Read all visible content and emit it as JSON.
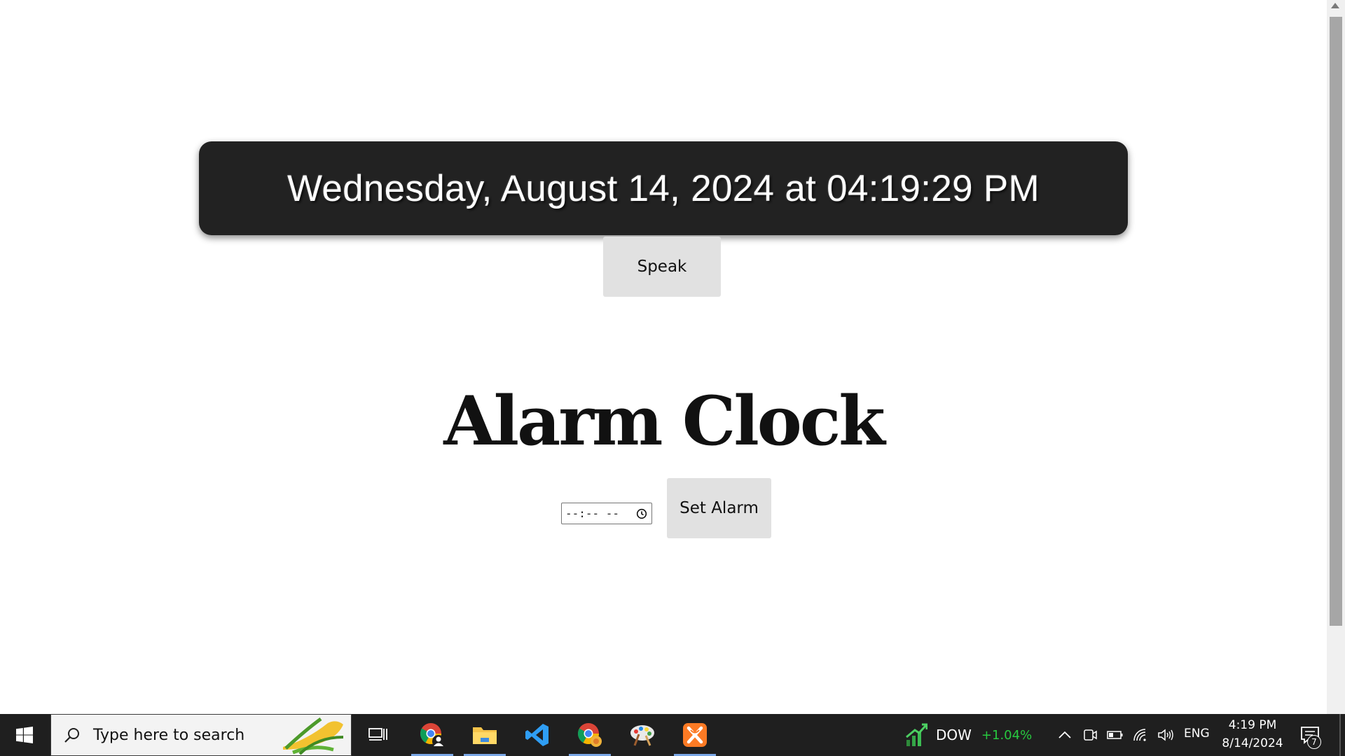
{
  "datetime": {
    "display": "Wednesday, August 14, 2024 at 04:19:29 PM"
  },
  "speak_button": {
    "label": "Speak"
  },
  "alarm": {
    "title": "Alarm Clock",
    "time_input_value": "--:-- --",
    "set_button_label": "Set Alarm"
  },
  "taskbar": {
    "search_placeholder": "Type here to search",
    "apps": [
      "chrome-profile-icon",
      "file-explorer-icon",
      "vscode-icon",
      "chrome-icon",
      "paint-icon",
      "xampp-icon"
    ],
    "stock": {
      "label": "DOW",
      "change": "+1.04%",
      "change_color": "#27c93f"
    },
    "language": "ENG",
    "time": "4:19 PM",
    "date": "8/14/2024",
    "notification_count": "7"
  },
  "colors": {
    "datetime_bg": "#222222",
    "button_bg": "#e1e1e1",
    "taskbar_bg": "#1f1f1f",
    "accent_underline": "#7aa7e6"
  }
}
